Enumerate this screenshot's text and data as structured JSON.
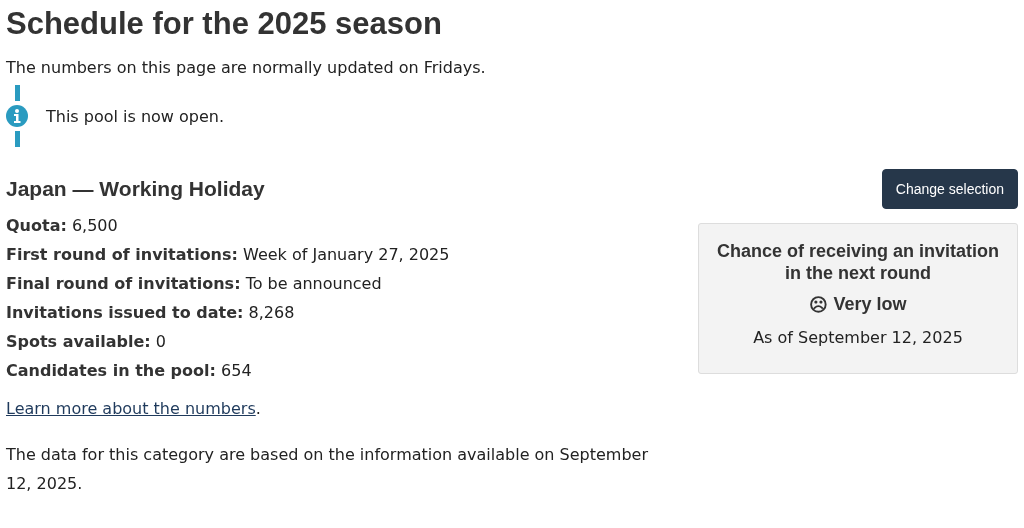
{
  "title": "Schedule for the 2025 season",
  "intro": "The numbers on this page are normally updated on Fridays.",
  "notice": {
    "kind": "info",
    "text": "This pool is now open."
  },
  "category": {
    "heading": "Japan — Working Holiday",
    "button": "Change selection"
  },
  "facts": [
    {
      "label": "Quota:",
      "value": "6,500"
    },
    {
      "label": "First round of invitations:",
      "value": "Week of January 27, 2025"
    },
    {
      "label": "Final round of invitations:",
      "value": "To be announced"
    },
    {
      "label": "Invitations issued to date:",
      "value": "8,268"
    },
    {
      "label": "Spots available:",
      "value": "0"
    },
    {
      "label": "Candidates in the pool:",
      "value": "654"
    }
  ],
  "learn_more": {
    "link": "Learn more about the numbers",
    "after": "."
  },
  "footnote": "The data for this category are based on the information available on September 12, 2025.",
  "chance": {
    "heading": "Chance of receiving an invitation in the next round",
    "symbol": "☹",
    "rating": "Very low",
    "as_of": "As of September 12, 2025"
  }
}
